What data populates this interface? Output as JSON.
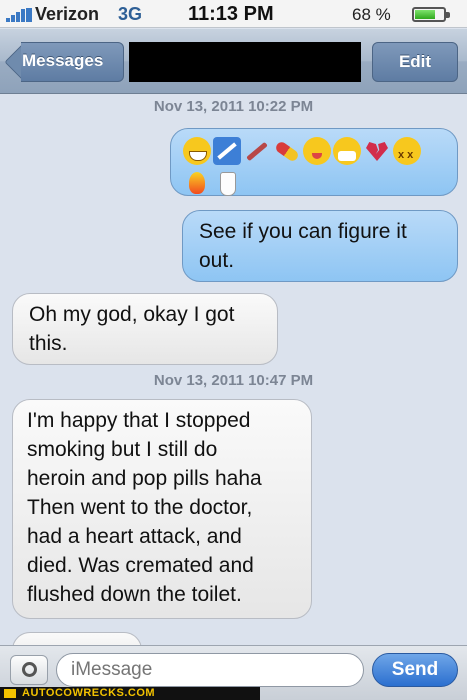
{
  "status_bar": {
    "carrier": "Verizon",
    "network": "3G",
    "time": "11:13 PM",
    "battery_text": "68 %",
    "battery_level": 0.68
  },
  "nav": {
    "back_label": "Messages",
    "contact_name_redacted": true,
    "edit_label": "Edit"
  },
  "messages": [
    {
      "type": "timestamp",
      "text": "Nov 13, 2011 10:22 PM"
    },
    {
      "type": "sent",
      "emojis": [
        "grinning-face-icon",
        "no-smoking-icon",
        "syringe-icon",
        "pill-icon",
        "winking-tongue-face-icon",
        "mask-face-icon",
        "broken-heart-icon",
        "dizzy-face-icon",
        "fire-icon",
        "toilet-icon"
      ]
    },
    {
      "type": "sent",
      "lines": [
        "See if you can figure it",
        "out."
      ]
    },
    {
      "type": "received",
      "lines": [
        "Oh my god, okay I got",
        "this."
      ]
    },
    {
      "type": "timestamp",
      "text": "Nov 13, 2011 10:47 PM"
    },
    {
      "type": "received",
      "lines": [
        "I'm happy that I stopped",
        "smoking but I still do",
        "heroin and pop pills haha",
        "Then went to the doctor,",
        "had a heart attack, and",
        "died. Was cremated and",
        "flushed down the toilet."
      ]
    }
  ],
  "input_bar": {
    "placeholder": "iMessage",
    "send_label": "Send"
  },
  "watermark": "AUTOCOWRECKS.COM",
  "colors": {
    "sent_bubble": "#a3cff6",
    "received_bubble": "#efefef",
    "nav_bar": "#a9b9cc",
    "background": "#dbe2ed"
  }
}
